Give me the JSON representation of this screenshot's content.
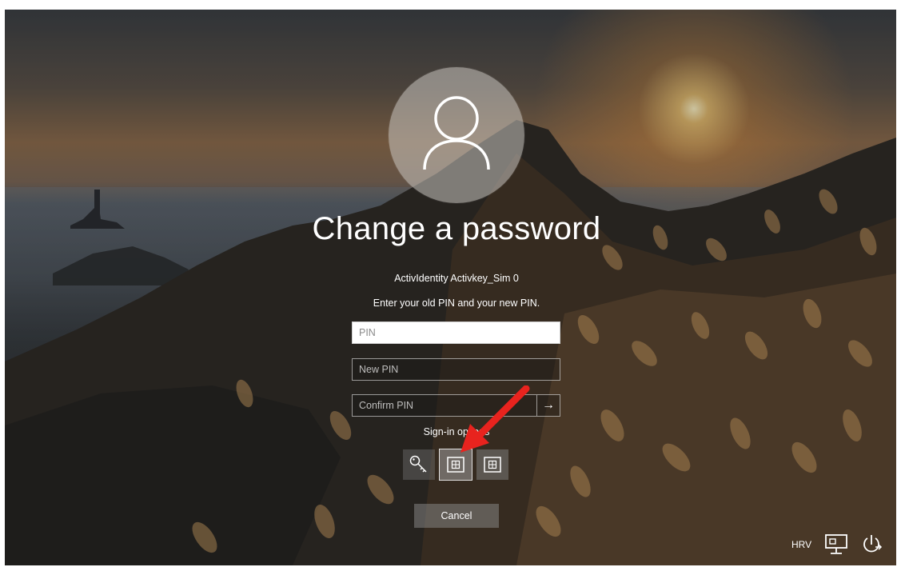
{
  "screen": {
    "title": "Change a password",
    "account": "ActivIdentity Activkey_Sim 0",
    "instruction": "Enter your old PIN and your new PIN."
  },
  "form": {
    "pin_placeholder": "PIN",
    "new_pin_placeholder": "New PIN",
    "confirm_pin_placeholder": "Confirm PIN",
    "submit_icon": "arrow-right-icon"
  },
  "sign_in_options": {
    "label": "Sign-in options",
    "options": [
      {
        "icon": "key-icon"
      },
      {
        "icon": "smart-card-icon",
        "selected": true
      },
      {
        "icon": "smart-card-icon"
      }
    ]
  },
  "cancel_label": "Cancel",
  "tray": {
    "language": "HRV",
    "icons": [
      "network-icon",
      "power-icon"
    ]
  },
  "annotation": {
    "icon": "red-arrow-icon",
    "color": "#e8231e"
  }
}
